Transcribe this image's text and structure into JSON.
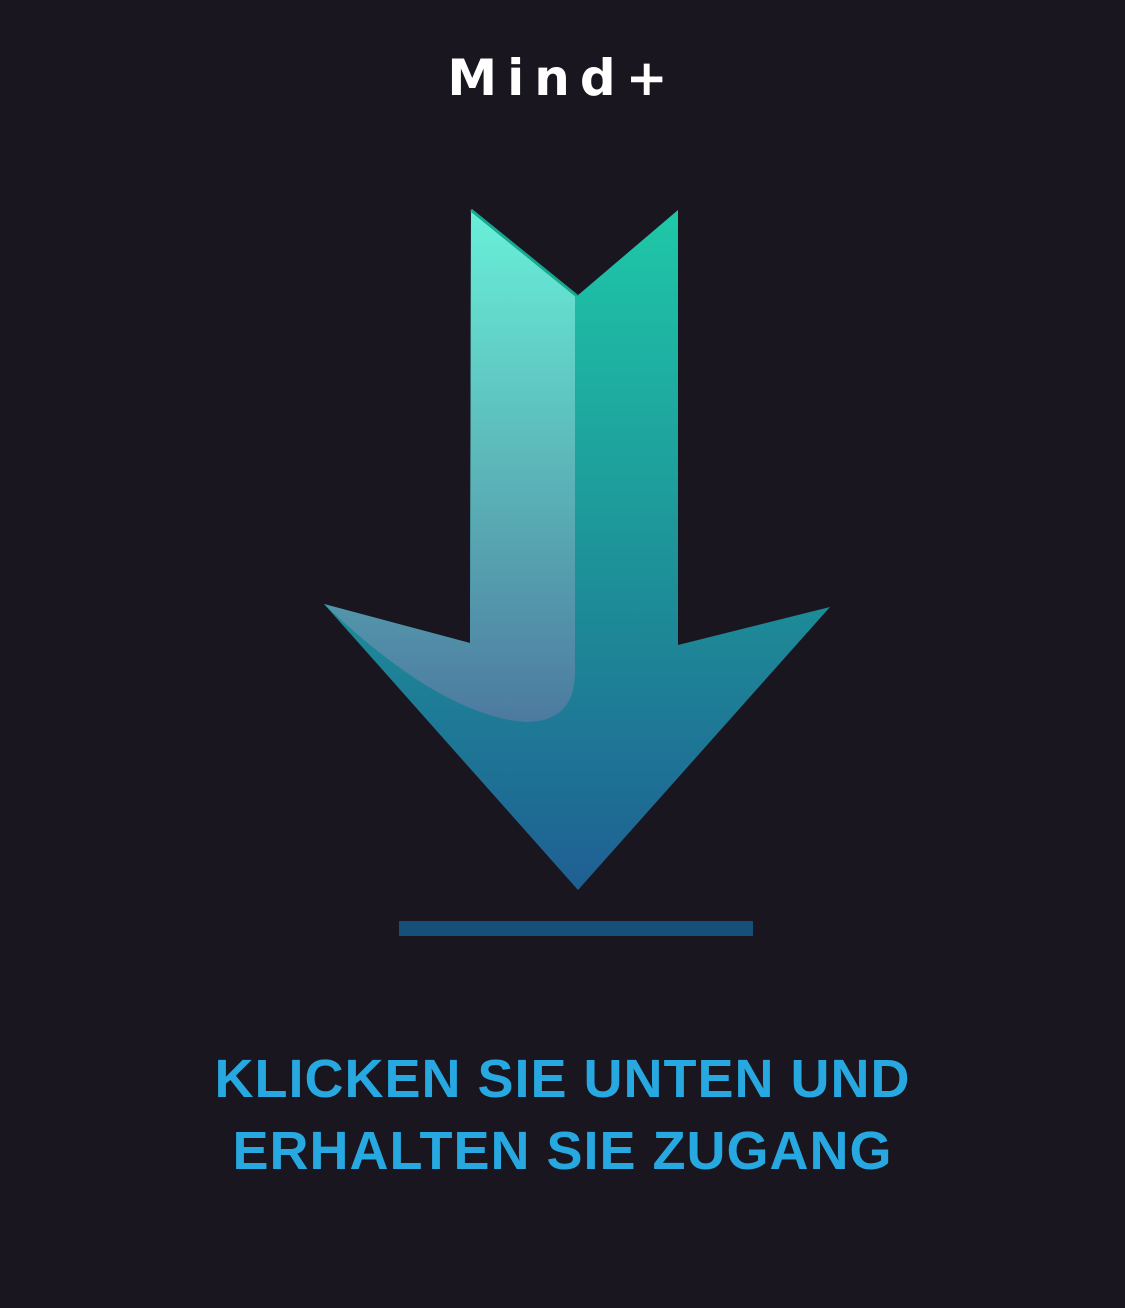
{
  "brand": {
    "name": "Mind+"
  },
  "cta": {
    "line1": "KLICKEN SIE UNTEN UND",
    "line2": "ERHALTEN SIE ZUGANG"
  },
  "icons": {
    "main": "download-arrow-icon",
    "baseline": "download-baseline"
  },
  "colors": {
    "background": "#19161f",
    "brand_text": "#ffffff",
    "cta_text": "#27a8e0",
    "arrow_top": "#1fc8a8",
    "arrow_bottom": "#1f5f93",
    "highlight_top": "#6cf2dc",
    "highlight_bottom": "#4f7aa0",
    "baseline": "#15507a"
  }
}
